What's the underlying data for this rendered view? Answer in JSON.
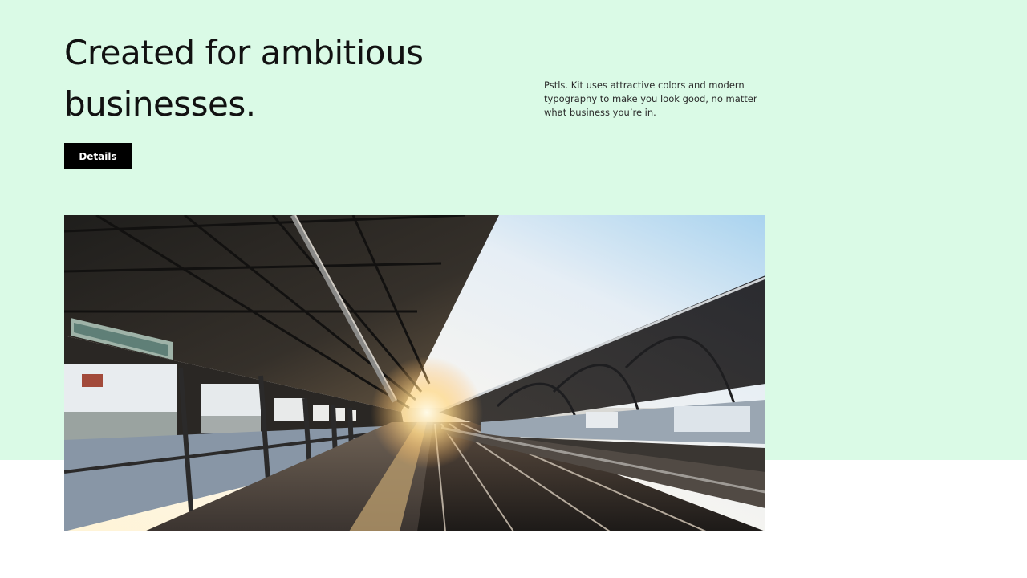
{
  "hero": {
    "headline": "Created for ambitious businesses.",
    "description": "Pstls. Kit uses attractive colors and modern typography to make you look good, no matter what business you’re in.",
    "details_label": "Details",
    "background_color": "#dafae6"
  },
  "photo": {
    "icon": "train-station-photo"
  }
}
